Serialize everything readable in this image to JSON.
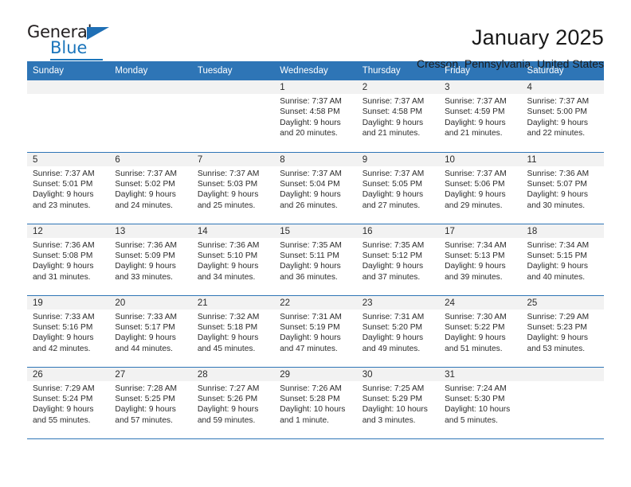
{
  "brand": {
    "word1": "General",
    "word2": "Blue",
    "triangle_color": "#1f6fb5",
    "blue_color": "#1b75bb"
  },
  "header": {
    "title": "January 2025",
    "subtitle": "Cresson, Pennsylvania, United States",
    "header_bg": "#2e75b6",
    "daynum_bg": "#f2f2f2"
  },
  "calendar": {
    "weekday_headers": [
      "Sunday",
      "Monday",
      "Tuesday",
      "Wednesday",
      "Thursday",
      "Friday",
      "Saturday"
    ],
    "weeks": [
      [
        {
          "day": "",
          "sunrise": "",
          "sunset": "",
          "daylight_line1": "",
          "daylight_line2": ""
        },
        {
          "day": "",
          "sunrise": "",
          "sunset": "",
          "daylight_line1": "",
          "daylight_line2": ""
        },
        {
          "day": "",
          "sunrise": "",
          "sunset": "",
          "daylight_line1": "",
          "daylight_line2": ""
        },
        {
          "day": "1",
          "sunrise": "Sunrise: 7:37 AM",
          "sunset": "Sunset: 4:58 PM",
          "daylight_line1": "Daylight: 9 hours",
          "daylight_line2": "and 20 minutes."
        },
        {
          "day": "2",
          "sunrise": "Sunrise: 7:37 AM",
          "sunset": "Sunset: 4:58 PM",
          "daylight_line1": "Daylight: 9 hours",
          "daylight_line2": "and 21 minutes."
        },
        {
          "day": "3",
          "sunrise": "Sunrise: 7:37 AM",
          "sunset": "Sunset: 4:59 PM",
          "daylight_line1": "Daylight: 9 hours",
          "daylight_line2": "and 21 minutes."
        },
        {
          "day": "4",
          "sunrise": "Sunrise: 7:37 AM",
          "sunset": "Sunset: 5:00 PM",
          "daylight_line1": "Daylight: 9 hours",
          "daylight_line2": "and 22 minutes."
        }
      ],
      [
        {
          "day": "5",
          "sunrise": "Sunrise: 7:37 AM",
          "sunset": "Sunset: 5:01 PM",
          "daylight_line1": "Daylight: 9 hours",
          "daylight_line2": "and 23 minutes."
        },
        {
          "day": "6",
          "sunrise": "Sunrise: 7:37 AM",
          "sunset": "Sunset: 5:02 PM",
          "daylight_line1": "Daylight: 9 hours",
          "daylight_line2": "and 24 minutes."
        },
        {
          "day": "7",
          "sunrise": "Sunrise: 7:37 AM",
          "sunset": "Sunset: 5:03 PM",
          "daylight_line1": "Daylight: 9 hours",
          "daylight_line2": "and 25 minutes."
        },
        {
          "day": "8",
          "sunrise": "Sunrise: 7:37 AM",
          "sunset": "Sunset: 5:04 PM",
          "daylight_line1": "Daylight: 9 hours",
          "daylight_line2": "and 26 minutes."
        },
        {
          "day": "9",
          "sunrise": "Sunrise: 7:37 AM",
          "sunset": "Sunset: 5:05 PM",
          "daylight_line1": "Daylight: 9 hours",
          "daylight_line2": "and 27 minutes."
        },
        {
          "day": "10",
          "sunrise": "Sunrise: 7:37 AM",
          "sunset": "Sunset: 5:06 PM",
          "daylight_line1": "Daylight: 9 hours",
          "daylight_line2": "and 29 minutes."
        },
        {
          "day": "11",
          "sunrise": "Sunrise: 7:36 AM",
          "sunset": "Sunset: 5:07 PM",
          "daylight_line1": "Daylight: 9 hours",
          "daylight_line2": "and 30 minutes."
        }
      ],
      [
        {
          "day": "12",
          "sunrise": "Sunrise: 7:36 AM",
          "sunset": "Sunset: 5:08 PM",
          "daylight_line1": "Daylight: 9 hours",
          "daylight_line2": "and 31 minutes."
        },
        {
          "day": "13",
          "sunrise": "Sunrise: 7:36 AM",
          "sunset": "Sunset: 5:09 PM",
          "daylight_line1": "Daylight: 9 hours",
          "daylight_line2": "and 33 minutes."
        },
        {
          "day": "14",
          "sunrise": "Sunrise: 7:36 AM",
          "sunset": "Sunset: 5:10 PM",
          "daylight_line1": "Daylight: 9 hours",
          "daylight_line2": "and 34 minutes."
        },
        {
          "day": "15",
          "sunrise": "Sunrise: 7:35 AM",
          "sunset": "Sunset: 5:11 PM",
          "daylight_line1": "Daylight: 9 hours",
          "daylight_line2": "and 36 minutes."
        },
        {
          "day": "16",
          "sunrise": "Sunrise: 7:35 AM",
          "sunset": "Sunset: 5:12 PM",
          "daylight_line1": "Daylight: 9 hours",
          "daylight_line2": "and 37 minutes."
        },
        {
          "day": "17",
          "sunrise": "Sunrise: 7:34 AM",
          "sunset": "Sunset: 5:13 PM",
          "daylight_line1": "Daylight: 9 hours",
          "daylight_line2": "and 39 minutes."
        },
        {
          "day": "18",
          "sunrise": "Sunrise: 7:34 AM",
          "sunset": "Sunset: 5:15 PM",
          "daylight_line1": "Daylight: 9 hours",
          "daylight_line2": "and 40 minutes."
        }
      ],
      [
        {
          "day": "19",
          "sunrise": "Sunrise: 7:33 AM",
          "sunset": "Sunset: 5:16 PM",
          "daylight_line1": "Daylight: 9 hours",
          "daylight_line2": "and 42 minutes."
        },
        {
          "day": "20",
          "sunrise": "Sunrise: 7:33 AM",
          "sunset": "Sunset: 5:17 PM",
          "daylight_line1": "Daylight: 9 hours",
          "daylight_line2": "and 44 minutes."
        },
        {
          "day": "21",
          "sunrise": "Sunrise: 7:32 AM",
          "sunset": "Sunset: 5:18 PM",
          "daylight_line1": "Daylight: 9 hours",
          "daylight_line2": "and 45 minutes."
        },
        {
          "day": "22",
          "sunrise": "Sunrise: 7:31 AM",
          "sunset": "Sunset: 5:19 PM",
          "daylight_line1": "Daylight: 9 hours",
          "daylight_line2": "and 47 minutes."
        },
        {
          "day": "23",
          "sunrise": "Sunrise: 7:31 AM",
          "sunset": "Sunset: 5:20 PM",
          "daylight_line1": "Daylight: 9 hours",
          "daylight_line2": "and 49 minutes."
        },
        {
          "day": "24",
          "sunrise": "Sunrise: 7:30 AM",
          "sunset": "Sunset: 5:22 PM",
          "daylight_line1": "Daylight: 9 hours",
          "daylight_line2": "and 51 minutes."
        },
        {
          "day": "25",
          "sunrise": "Sunrise: 7:29 AM",
          "sunset": "Sunset: 5:23 PM",
          "daylight_line1": "Daylight: 9 hours",
          "daylight_line2": "and 53 minutes."
        }
      ],
      [
        {
          "day": "26",
          "sunrise": "Sunrise: 7:29 AM",
          "sunset": "Sunset: 5:24 PM",
          "daylight_line1": "Daylight: 9 hours",
          "daylight_line2": "and 55 minutes."
        },
        {
          "day": "27",
          "sunrise": "Sunrise: 7:28 AM",
          "sunset": "Sunset: 5:25 PM",
          "daylight_line1": "Daylight: 9 hours",
          "daylight_line2": "and 57 minutes."
        },
        {
          "day": "28",
          "sunrise": "Sunrise: 7:27 AM",
          "sunset": "Sunset: 5:26 PM",
          "daylight_line1": "Daylight: 9 hours",
          "daylight_line2": "and 59 minutes."
        },
        {
          "day": "29",
          "sunrise": "Sunrise: 7:26 AM",
          "sunset": "Sunset: 5:28 PM",
          "daylight_line1": "Daylight: 10 hours",
          "daylight_line2": "and 1 minute."
        },
        {
          "day": "30",
          "sunrise": "Sunrise: 7:25 AM",
          "sunset": "Sunset: 5:29 PM",
          "daylight_line1": "Daylight: 10 hours",
          "daylight_line2": "and 3 minutes."
        },
        {
          "day": "31",
          "sunrise": "Sunrise: 7:24 AM",
          "sunset": "Sunset: 5:30 PM",
          "daylight_line1": "Daylight: 10 hours",
          "daylight_line2": "and 5 minutes."
        },
        {
          "day": "",
          "sunrise": "",
          "sunset": "",
          "daylight_line1": "",
          "daylight_line2": ""
        }
      ]
    ]
  }
}
